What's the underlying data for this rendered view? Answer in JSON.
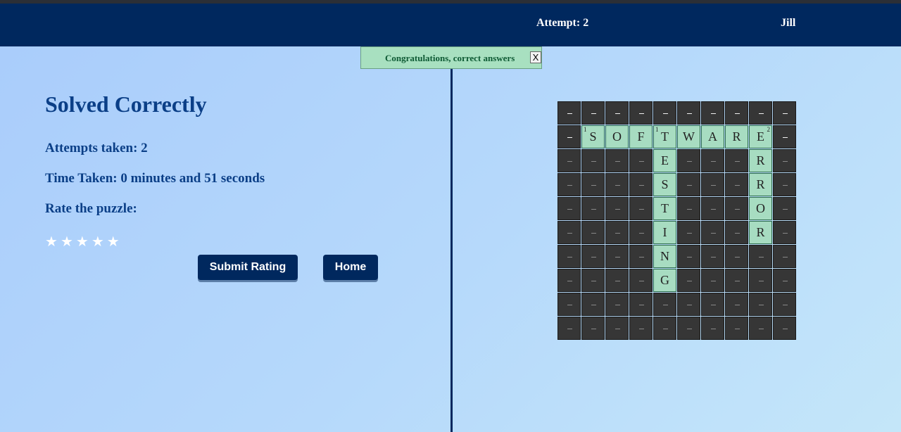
{
  "header": {
    "attempt": "Attempt: 2",
    "user": "Jill"
  },
  "toast": {
    "message": "Congratulations, correct answers",
    "close": "X"
  },
  "result": {
    "title": "Solved Correctly",
    "attempts": "Attempts taken: 2",
    "time": "Time Taken: 0 minutes and 51 seconds",
    "rate_label": "Rate the puzzle:",
    "stars": [
      "★",
      "★",
      "★",
      "★",
      "★"
    ],
    "rating": 0
  },
  "buttons": {
    "submit": "Submit Rating",
    "home": "Home"
  },
  "crossword": {
    "rows": 10,
    "cols": 10,
    "cells": [
      "..........",
      ".SOFTWARE.",
      "....E...R.",
      "....S...R.",
      "....T...O.",
      "....I...R.",
      "....N.....",
      "....G.....",
      "..........",
      ".........."
    ],
    "numbers": [
      {
        "row": 1,
        "col": 1,
        "n": "1"
      },
      {
        "row": 1,
        "col": 4,
        "n": "1"
      },
      {
        "row": 1,
        "col": 8,
        "n": "2"
      }
    ],
    "colors": {
      "letter_bg": "#a7dcc1",
      "block_bg": "#363636"
    }
  },
  "colors": {
    "header": "#00285e",
    "title": "#0b3f87",
    "toast_bg": "#a8e0c0"
  }
}
